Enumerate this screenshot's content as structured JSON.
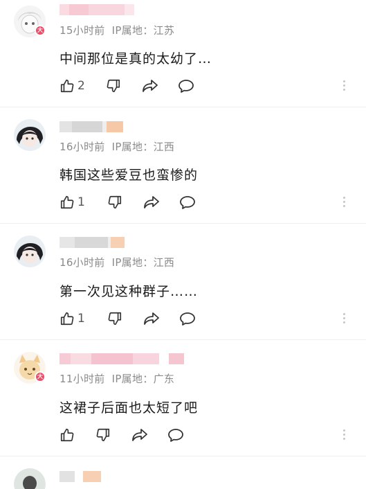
{
  "comments": [
    {
      "time": "15小时前",
      "location": "IP属地：江苏",
      "text": "中间那位是真的太幼了…",
      "likes": "2",
      "badge": "大"
    },
    {
      "time": "16小时前",
      "location": "IP属地：江西",
      "text": "韩国这些爱豆也蛮惨的",
      "likes": "1"
    },
    {
      "time": "16小时前",
      "location": "IP属地：江西",
      "text": "第一次见这种群子……",
      "likes": "1"
    },
    {
      "time": "11小时前",
      "location": "IP属地：广东",
      "text": "这裙子后面也太短了吧",
      "likes": "",
      "badge": "大"
    }
  ],
  "icons": {
    "like": "thumbs-up-icon",
    "dislike": "thumbs-down-icon",
    "share": "share-icon",
    "reply": "comment-bubble-icon",
    "more": "more-vertical-icon"
  },
  "colors": {
    "name_blur_pink": "#f6c9d3",
    "name_blur_orange": "#f7c8a8",
    "name_blur_gray": "#dcdcdc",
    "badge": "#ea4e6a",
    "meta_text": "#8a8a8a"
  }
}
